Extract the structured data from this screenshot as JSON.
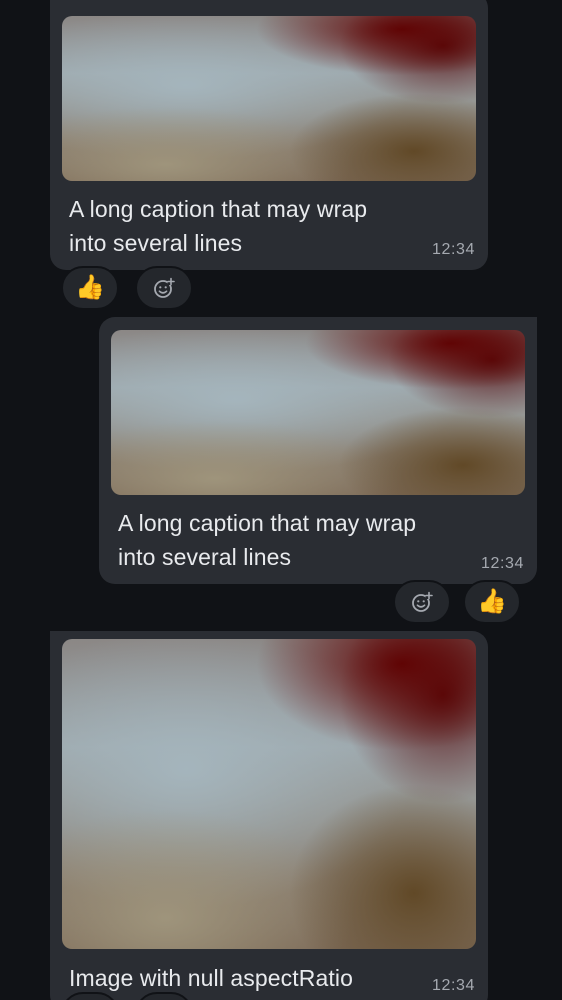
{
  "messages": [
    {
      "caption": "A long caption that may wrap into several lines",
      "time": "12:34",
      "reaction_emoji": "👍"
    },
    {
      "caption": "A long caption that may wrap into several lines",
      "time": "12:34",
      "reaction_emoji": "👍"
    },
    {
      "caption": "Image with null aspectRatio",
      "time": "12:34"
    }
  ],
  "icons": {
    "add_reaction": "add-reaction-icon"
  },
  "colors": {
    "background": "#101216",
    "bubble": "#2a2d33",
    "chip": "#24272c",
    "caption_text": "#e8eaed",
    "time_text": "#a5a9b0"
  }
}
